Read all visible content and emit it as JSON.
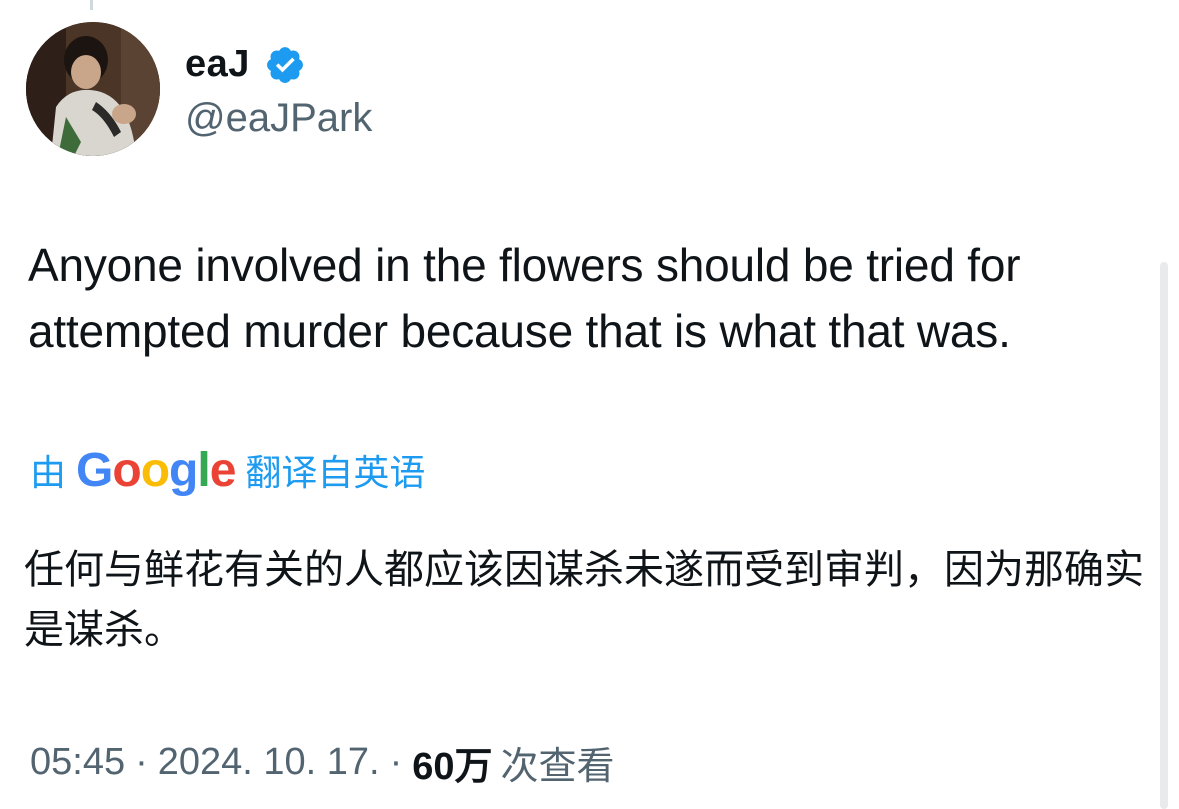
{
  "author": {
    "display_name": "eaJ",
    "handle": "@eaJPark",
    "verified": true,
    "verified_color": "#1d9bf0"
  },
  "tweet": {
    "text": "Anyone involved in the flowers should be tried for attempted murder because that is what that was."
  },
  "translation": {
    "by_label": "由",
    "provider": "Google",
    "from_label": "翻译自英语",
    "text": "任何与鲜花有关的人都应该因谋杀未遂而受到审判，因为那确实是谋杀。"
  },
  "meta": {
    "time": "05:45",
    "date": "2024. 10. 17.",
    "views_count": "60万",
    "views_label": "次查看"
  },
  "colors": {
    "text": "#0f1419",
    "secondary": "#536471",
    "link": "#1d9bf0"
  }
}
